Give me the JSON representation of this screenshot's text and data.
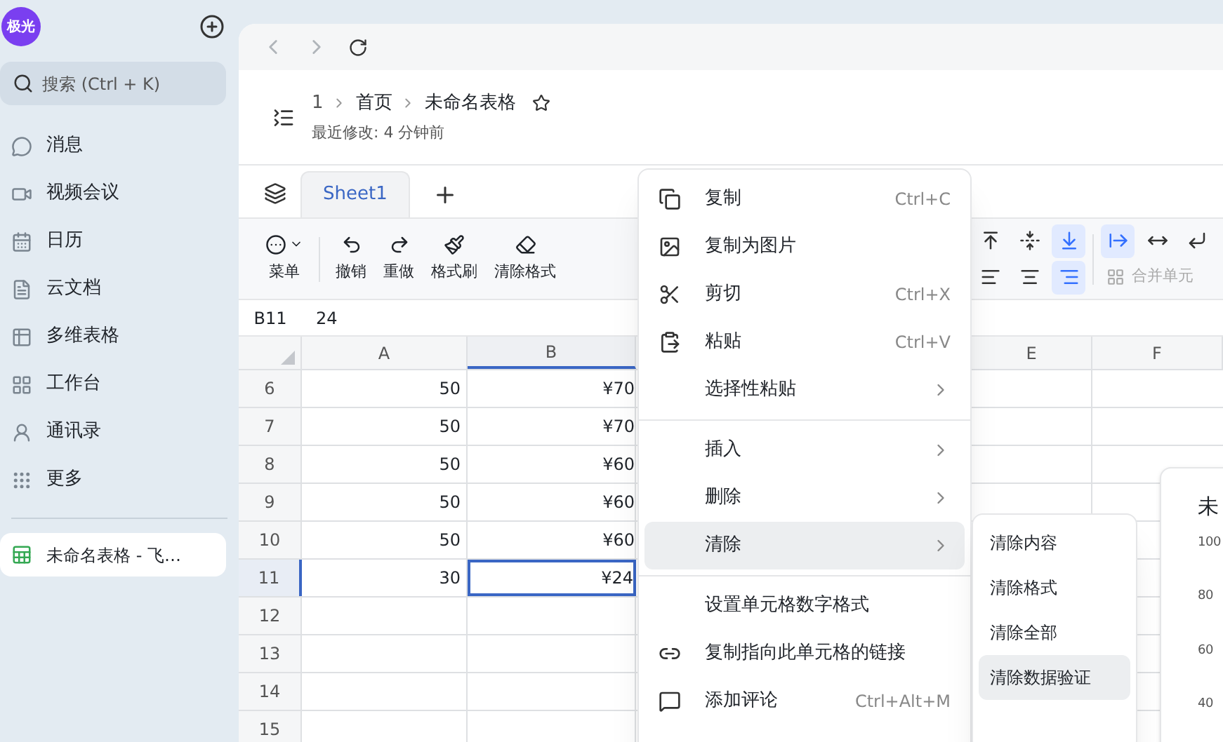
{
  "sidebar": {
    "avatar": "极光",
    "search": {
      "placeholder": "搜索 (Ctrl + K)"
    },
    "items": [
      {
        "label": "消息",
        "selected": false
      },
      {
        "label": "视频会议",
        "selected": false
      },
      {
        "label": "日历",
        "selected": false
      },
      {
        "label": "云文档",
        "selected": false
      },
      {
        "label": "多维表格",
        "selected": false
      },
      {
        "label": "工作台",
        "selected": false
      },
      {
        "label": "通讯录",
        "selected": false
      },
      {
        "label": "更多",
        "selected": false
      }
    ],
    "recent": [
      {
        "label": "未命名表格 - 飞…",
        "selected": true
      }
    ]
  },
  "header": {
    "breadcrumb": [
      "1",
      "首页",
      "未命名表格"
    ],
    "modified": "最近修改: 4 分钟前"
  },
  "tabs": [
    {
      "label": "Sheet1",
      "selected": true
    }
  ],
  "toolbar": {
    "items": [
      {
        "label": "菜单"
      },
      {
        "label": "撤销"
      },
      {
        "label": "重做"
      },
      {
        "label": "格式刷"
      },
      {
        "label": "清除格式"
      }
    ],
    "align_top": [
      {
        "selected": false
      },
      {
        "selected": false
      },
      {
        "selected": true
      }
    ],
    "align_bottom": [
      {
        "selected": false
      },
      {
        "selected": false
      },
      {
        "selected": true
      }
    ],
    "text_controls": [
      {
        "selected": true
      },
      {
        "selected": false
      },
      {
        "selected": false
      }
    ],
    "merge": "合并单元"
  },
  "formula_bar": {
    "cell": "B11",
    "value": "24"
  },
  "columns": [
    {
      "label": "A"
    },
    {
      "label": "B"
    },
    {
      "label": "E"
    },
    {
      "label": "F"
    }
  ],
  "rows": [
    {
      "number": "6",
      "a": "50",
      "b": "¥70",
      "selected": false
    },
    {
      "number": "7",
      "a": "50",
      "b": "¥70",
      "selected": false
    },
    {
      "number": "8",
      "a": "50",
      "b": "¥60",
      "selected": false
    },
    {
      "number": "9",
      "a": "50",
      "b": "¥60",
      "selected": false
    },
    {
      "number": "10",
      "a": "50",
      "b": "¥60",
      "selected": false
    },
    {
      "number": "11",
      "a": "30",
      "b": "¥24",
      "selected": true
    },
    {
      "number": "12",
      "selected": false
    },
    {
      "number": "13",
      "selected": false
    },
    {
      "number": "14",
      "selected": false
    },
    {
      "number": "15",
      "selected": false
    }
  ],
  "chart_card": {
    "title": "未",
    "ticks": [
      "100",
      "80",
      "60",
      "40"
    ]
  },
  "context_menu": [
    {
      "kind": "item",
      "label": "复制",
      "shortcut": "Ctrl+C",
      "selected": false
    },
    {
      "kind": "item",
      "label": "复制为图片",
      "selected": false
    },
    {
      "kind": "item",
      "label": "剪切",
      "shortcut": "Ctrl+X",
      "selected": false
    },
    {
      "kind": "item",
      "label": "粘贴",
      "shortcut": "Ctrl+V",
      "selected": false
    },
    {
      "kind": "submenu",
      "label": "选择性粘贴",
      "selected": false
    },
    {
      "kind": "divider"
    },
    {
      "kind": "submenu",
      "label": "插入",
      "selected": false
    },
    {
      "kind": "submenu",
      "label": "删除",
      "selected": false
    },
    {
      "kind": "submenu",
      "label": "清除",
      "selected": true
    },
    {
      "kind": "divider"
    },
    {
      "kind": "item",
      "label": "设置单元格数字格式",
      "selected": false
    },
    {
      "kind": "item",
      "label": "复制指向此单元格的链接",
      "selected": false
    },
    {
      "kind": "item",
      "label": "添加评论",
      "shortcut": "Ctrl+Alt+M",
      "selected": false
    }
  ],
  "submenu": [
    {
      "label": "清除内容",
      "selected": false
    },
    {
      "label": "清除格式",
      "selected": false
    },
    {
      "label": "清除全部",
      "selected": false
    },
    {
      "label": "清除数据验证",
      "selected": true
    }
  ]
}
